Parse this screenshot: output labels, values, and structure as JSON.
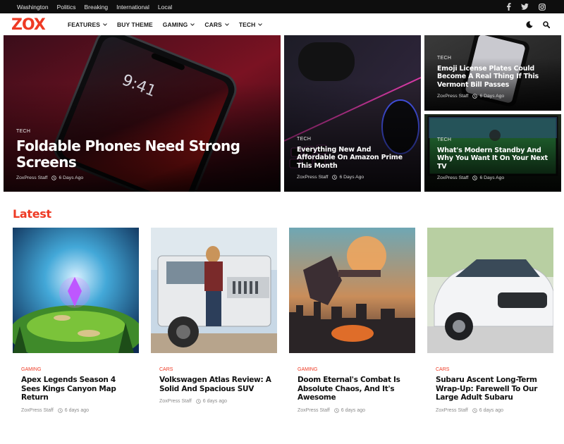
{
  "topbar": {
    "links": [
      "Washington",
      "Politics",
      "Breaking",
      "International",
      "Local"
    ],
    "social": [
      "facebook-icon",
      "twitter-icon",
      "instagram-icon"
    ]
  },
  "header": {
    "logo": "ZOX",
    "nav": [
      {
        "label": "FEATURES",
        "dropdown": true
      },
      {
        "label": "BUY THEME",
        "dropdown": false
      },
      {
        "label": "GAMING",
        "dropdown": true
      },
      {
        "label": "CARS",
        "dropdown": true
      },
      {
        "label": "TECH",
        "dropdown": true
      }
    ],
    "tools": [
      "dark-mode-icon",
      "search-icon"
    ]
  },
  "hero": {
    "main": {
      "category": "TECH",
      "title": "Foldable Phones Need Strong Screens",
      "author": "ZoxPress Staff",
      "time": "6 Days Ago"
    },
    "middle": {
      "category": "TECH",
      "title": "Everything New And Affordable On Amazon Prime This Month",
      "author": "ZoxPress Staff",
      "time": "6 Days Ago"
    },
    "right_top": {
      "category": "TECH",
      "title": "Emoji License Plates Could Become A Real Thing If This Vermont Bill Passes",
      "author": "ZoxPress Staff",
      "time": "6 Days Ago"
    },
    "right_bottom": {
      "category": "TECH",
      "title": "What's Modern Standby And Why You Want It On Your Next TV",
      "author": "ZoxPress Staff",
      "time": "6 Days Ago"
    }
  },
  "latest": {
    "heading": "Latest",
    "posts": [
      {
        "category": "GAMING",
        "title": "Apex Legends Season 4 Sees Kings Canyon Map Return",
        "author": "ZoxPress Staff",
        "time": "6 days ago"
      },
      {
        "category": "CARS",
        "title": "Volkswagen Atlas Review: A Solid And Spacious SUV",
        "author": "ZoxPress Staff",
        "time": "6 days ago"
      },
      {
        "category": "GAMING",
        "title": "Doom Eternal's Combat Is Absolute Chaos, And It's Awesome",
        "author": "ZoxPress Staff",
        "time": "6 days ago"
      },
      {
        "category": "CARS",
        "title": "Subaru Ascent Long-Term Wrap-Up: Farewell To Our Large Adult Subaru",
        "author": "ZoxPress Staff",
        "time": "6 days ago"
      }
    ]
  },
  "colors": {
    "accent": "#ee3a24",
    "topbar": "#0e0e0e",
    "text": "#111111",
    "meta": "#8a8a8a"
  }
}
